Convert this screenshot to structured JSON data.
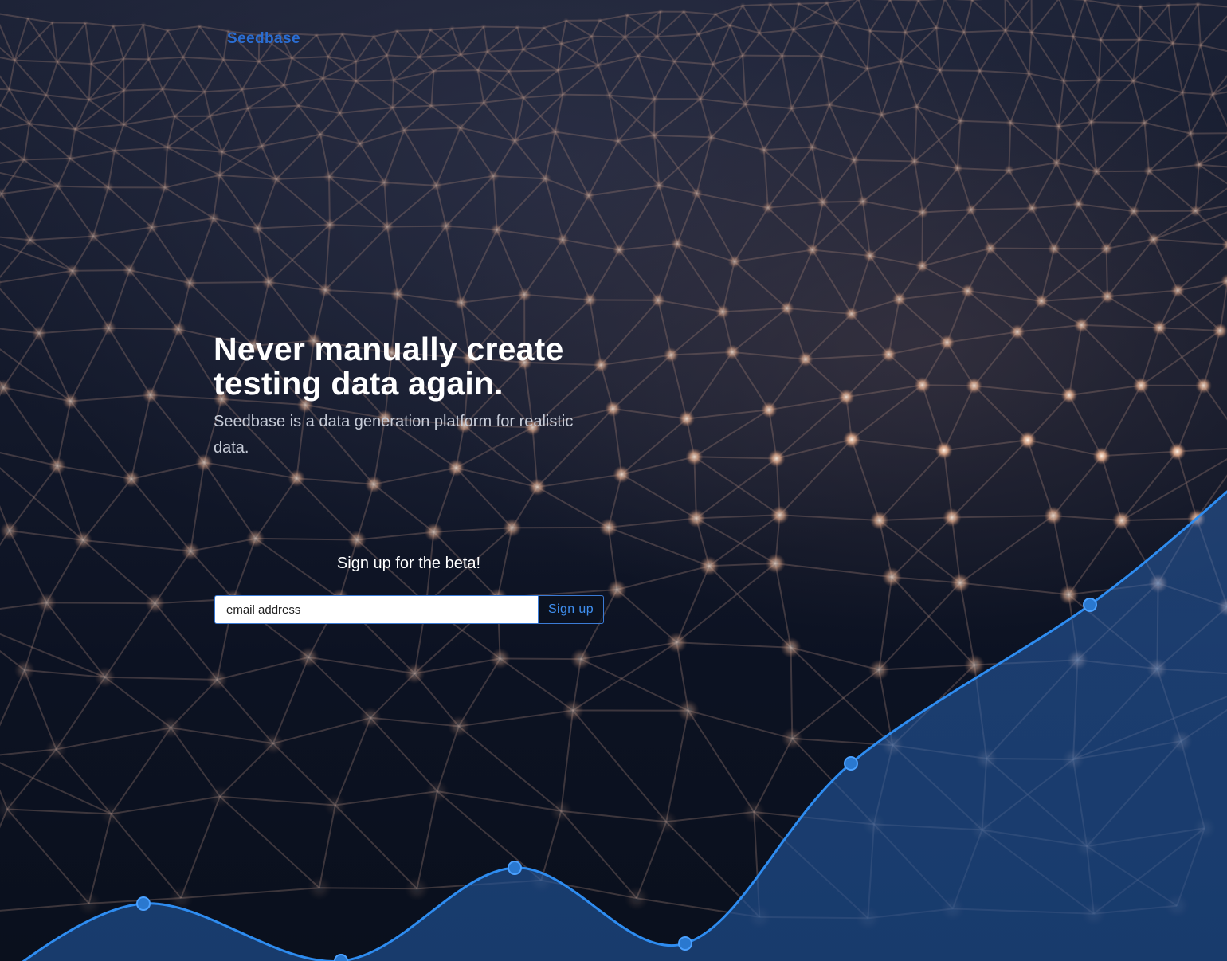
{
  "brand": {
    "name": "Seedbase",
    "accent": "#2a6dd2"
  },
  "hero": {
    "title": "Never manually create testing data again.",
    "subtitle": "Seedbase is a data generation platform for realistic data."
  },
  "signup": {
    "label": "Sign up for the beta!",
    "email_placeholder": "email address",
    "button_label": "Sign up"
  },
  "colors": {
    "line": "#2e8cf0",
    "node": "#d9a98a"
  },
  "icons": {
    "background": "network-mesh-graphic",
    "trend": "trend-line-graphic"
  }
}
